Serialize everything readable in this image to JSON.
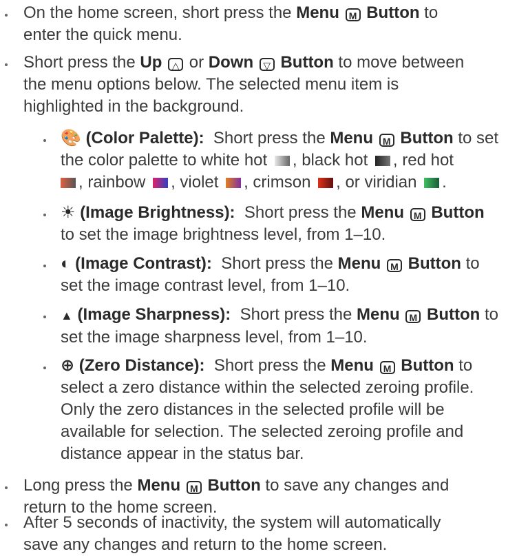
{
  "items": {
    "home": {
      "pre": "On the home screen, short press the ",
      "bold1": "Menu",
      "glyph": "M",
      "bold2": "Button",
      "post1": " to",
      "line2": "enter the quick menu."
    },
    "nav": {
      "pre": "Short press the ",
      "up": "Up",
      "or": " or ",
      "down": "Down",
      "bold2": "Button",
      "post1": " to move between",
      "line2": "the menu options below. The selected menu item is",
      "line3": "highlighted in the background."
    },
    "palette": {
      "icon": "🎨",
      "label": "(Color Palette):",
      "pre": "  Short press the ",
      "bold1": "Menu",
      "glyph": "M",
      "bold2": "Button",
      "post1": " to set",
      "line2a": "the color palette to white hot ",
      "line2b": ", black hot ",
      "line2c": ", red hot",
      "line3a": ", rainbow ",
      "line3b": ", violet ",
      "line3c": ", crimson ",
      "line3d": ", or viridian ",
      "line3e": "."
    },
    "brightness": {
      "icon": "☀",
      "label": "(Image Brightness):",
      "pre": "  Short press the ",
      "bold1": "Menu",
      "glyph": "M",
      "bold2": "Button",
      "line2": "to set the image brightness level, from 1–10."
    },
    "contrast": {
      "icon": "◐",
      "label": "(Image Contrast):",
      "pre": "  Short press the ",
      "bold1": "Menu",
      "glyph": "M",
      "bold2": "Button",
      "post1": " to",
      "line2": "set the image contrast level, from 1–10."
    },
    "sharpness": {
      "icon": "▲",
      "label": "(Image Sharpness):",
      "pre": "  Short press the ",
      "bold1": "Menu",
      "glyph": "M",
      "bold2": "Button",
      "post1": " to",
      "line2": "set the image sharpness level, from 1–10."
    },
    "zero": {
      "icon": "⊕",
      "label": "(Zero Distance):",
      "pre": "  Short press the ",
      "bold1": "Menu",
      "glyph": "M",
      "bold2": "Button",
      "post1": " to",
      "line2": "select a zero distance within the selected zeroing profile.",
      "line3": "Only the zero distances in the selected profile will be",
      "line4": "available for selection. The selected zeroing profile and",
      "line5": "distance appear in the status bar."
    },
    "longpress": {
      "pre": "Long press the ",
      "bold1": "Menu",
      "glyph": "M",
      "bold2": "Button",
      "post1": " to save any changes and",
      "line2": "return to the home screen."
    },
    "timeout": {
      "line1": "After 5 seconds of inactivity, the system will automatically",
      "line2": "save any changes and return to the home screen."
    }
  },
  "glyphs": {
    "up": "△",
    "down": "▽"
  },
  "palette_swatches": {
    "white_hot": "#9a9a9a",
    "black_hot": "#333333",
    "red_hot": "#d0443a",
    "rainbow": "#d3237a",
    "violet": "#b040a8",
    "crimson": "#c82020",
    "viridian": "#2e9a50"
  }
}
